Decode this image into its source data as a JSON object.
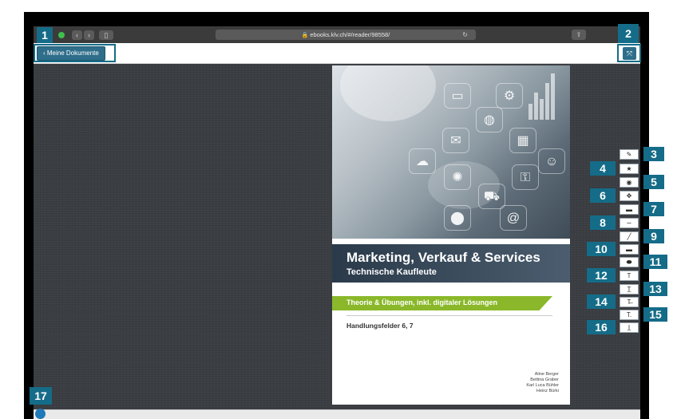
{
  "browser": {
    "url": "ebooks.klv.ch/#/reader/98558/",
    "back_icon": "chevron-left-icon",
    "forward_icon": "chevron-right-icon",
    "sidebar_icon": "sidebar-icon",
    "reload_icon": "reload-icon",
    "share_icon": "share-icon"
  },
  "appbar": {
    "back_label": "‹ Meine Dokumente",
    "fullscreen_icon": "fullscreen-icon"
  },
  "book": {
    "title": "Marketing, Verkauf & Services",
    "subtitle": "Technische Kaufleute",
    "band": "Theorie & Übungen, inkl. digitaler Lösungen",
    "fields": "Handlungsfelder 6, 7",
    "authors": [
      "Aline Berger",
      "Bettina Graber",
      "Karl Luca Bühler",
      "Heinz Bürki"
    ]
  },
  "tools": [
    {
      "icon": "pen-icon",
      "glyph": "✎"
    },
    {
      "icon": "star-icon",
      "glyph": "★"
    },
    {
      "icon": "eye-icon",
      "glyph": "◉"
    },
    {
      "icon": "move-icon",
      "glyph": "✥"
    },
    {
      "icon": "comment-icon",
      "glyph": "▬"
    },
    {
      "icon": "freehand-icon",
      "glyph": "∼"
    },
    {
      "icon": "line-icon",
      "glyph": "╱"
    },
    {
      "icon": "rectangle-icon",
      "glyph": "▬"
    },
    {
      "icon": "ellipse-icon",
      "glyph": "⬬"
    },
    {
      "icon": "text-box-icon",
      "glyph": "T"
    },
    {
      "icon": "underline-icon",
      "glyph": "T̲"
    },
    {
      "icon": "strikethrough-icon",
      "glyph": "T̶"
    },
    {
      "icon": "text-small-icon",
      "glyph": "T."
    },
    {
      "icon": "text-underline-icon",
      "glyph": "I̲"
    }
  ],
  "labels": [
    "1",
    "2",
    "3",
    "4",
    "5",
    "6",
    "7",
    "8",
    "9",
    "10",
    "11",
    "12",
    "13",
    "14",
    "15",
    "16",
    "17"
  ]
}
